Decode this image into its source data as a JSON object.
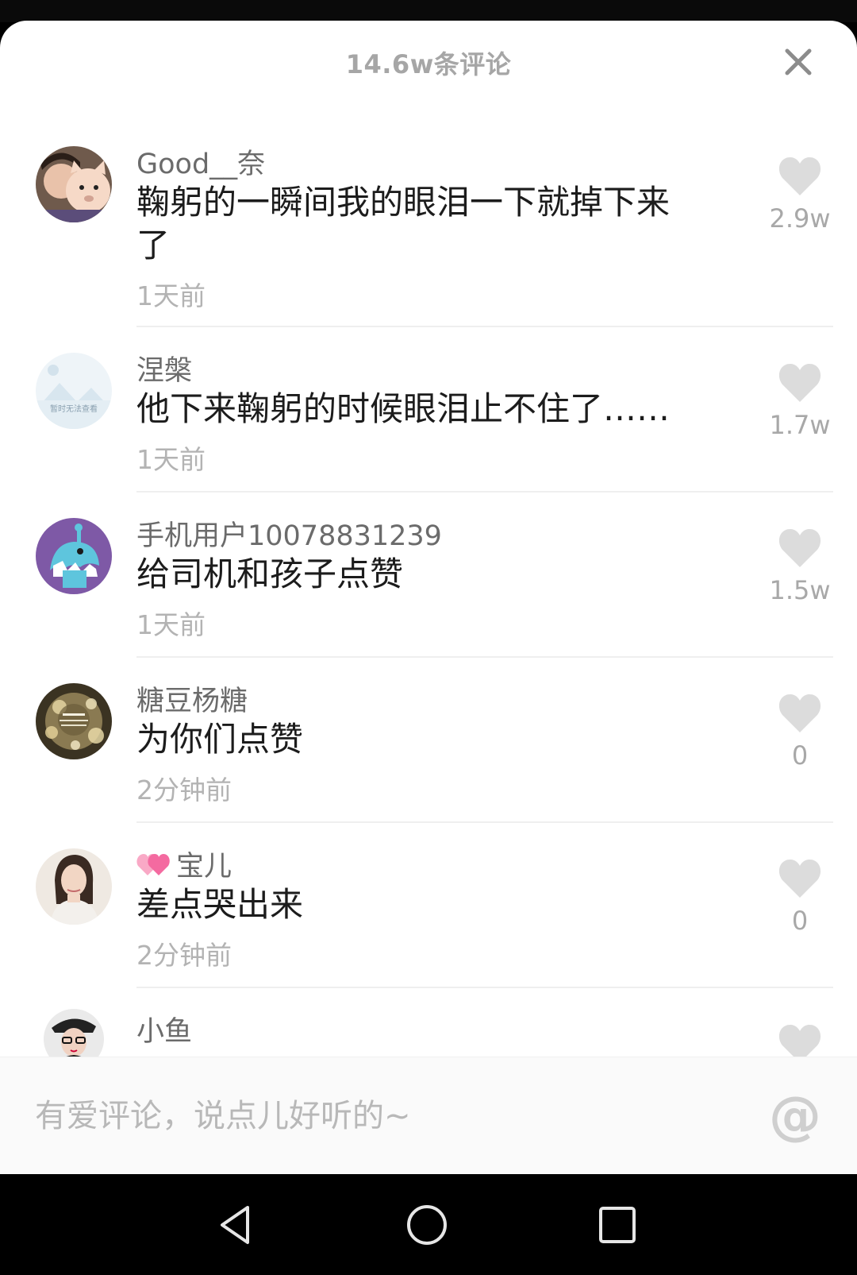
{
  "header": {
    "title": "14.6w条评论"
  },
  "comments": [
    {
      "username": "Good__奈",
      "text": "鞠躬的一瞬间我的眼泪一下就掉下来了",
      "time": "1天前",
      "likes": "2.9w"
    },
    {
      "username": "涅槃",
      "text": "他下来鞠躬的时候眼泪止不住了……",
      "time": "1天前",
      "likes": "1.7w",
      "avatar_text": "暂时无法查看"
    },
    {
      "username": "手机用户10078831239",
      "text": "给司机和孩子点赞",
      "time": "1天前",
      "likes": "1.5w"
    },
    {
      "username": "糖豆杨糖",
      "text": "为你们点赞",
      "time": "2分钟前",
      "likes": "0"
    },
    {
      "username": "宝儿",
      "text": "差点哭出来",
      "time": "2分钟前",
      "likes": "0"
    },
    {
      "username": "小鱼",
      "text": "",
      "time": "",
      "likes": ""
    }
  ],
  "input": {
    "placeholder": "有爱评论，说点儿好听的~",
    "at_label": "@"
  },
  "icons": {
    "close": "close-icon",
    "like": "heart-icon",
    "back": "back-triangle-icon",
    "home": "home-circle-icon",
    "recents": "recents-square-icon"
  },
  "colors": {
    "heart": "#dcdcdc",
    "heart_pink": "#f46aa0",
    "avatar_purple": "#7e59a6"
  }
}
